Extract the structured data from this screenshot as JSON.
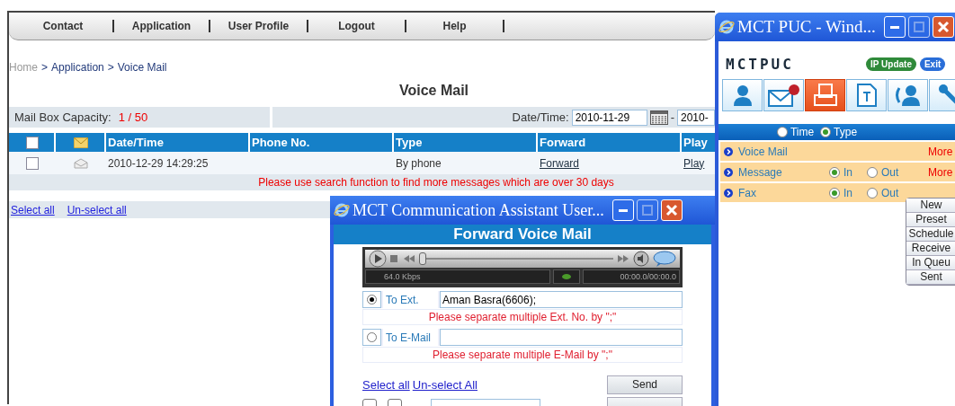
{
  "main": {
    "nav": [
      "Contact",
      "Application",
      "User Profile",
      "Logout",
      "Help"
    ],
    "breadcrumb": [
      {
        "label": "Home",
        "kind": "muted"
      },
      {
        "label": ">",
        "kind": "separator"
      },
      {
        "label": "Application",
        "kind": "link"
      },
      {
        "label": ">",
        "kind": "separator"
      },
      {
        "label": "Voice Mail",
        "kind": "link"
      }
    ],
    "title": "Voice Mail",
    "capacity": {
      "label": "Mail Box Capacity:",
      "value": "1 / 50"
    },
    "date_filter": {
      "label": "Date/Time:",
      "from": "2010-11-29",
      "separator": "-",
      "to": "2010-"
    },
    "table": {
      "header_checked": false,
      "columns": [
        "Date/Time",
        "Phone No.",
        "Type",
        "Forward",
        "Play"
      ],
      "rows": [
        {
          "checked": false,
          "date": "2010-12-29 14:29:25",
          "type": "By phone",
          "forward": "Forward",
          "play": "Play"
        }
      ]
    },
    "notice": "Please use search function to find more messages which are over 30 days",
    "select_all": "Select all",
    "unselect_all": "Un-select all"
  },
  "puc": {
    "title": "MCT PUC - Wind...",
    "logo": "MCTPUC",
    "buttons": [
      {
        "label": "IP Update",
        "kind": "green"
      },
      {
        "label": "Exit",
        "kind": "blue"
      }
    ],
    "tabs": [
      {
        "kind": "person",
        "selected": false
      },
      {
        "kind": "mail",
        "selected": false
      },
      {
        "kind": "fax",
        "selected": true
      },
      {
        "kind": "text",
        "selected": false
      },
      {
        "kind": "call",
        "selected": false
      },
      {
        "kind": "tool",
        "selected": false
      }
    ],
    "sort": [
      {
        "label": "Time",
        "selected": false
      },
      {
        "label": "Type",
        "selected": true
      }
    ],
    "categories": [
      {
        "label": "Voice Mail",
        "more": "More"
      },
      {
        "label": "Message",
        "directions": [
          {
            "label": "In",
            "selected": true
          },
          {
            "label": "Out",
            "selected": false
          }
        ],
        "more": "More"
      },
      {
        "label": "Fax",
        "directions": [
          {
            "label": "In",
            "selected": true
          },
          {
            "label": "Out",
            "selected": false
          }
        ]
      }
    ],
    "menu": [
      "New",
      "Preset",
      "Schedule",
      "Receive",
      "In Queu",
      "Sent"
    ]
  },
  "dialog": {
    "title": "MCT Communication Assistant User...",
    "heading": "Forward Voice Mail",
    "player": {
      "bitrate": "64.0 Kbps",
      "time": "00:00.0/00:00.0",
      "level": 0
    },
    "recipients": [
      {
        "label": "To Ext.",
        "selected": true,
        "value": "Aman Basra(6606);",
        "note": "Please separate multiple Ext. No. by \";\""
      },
      {
        "label": "To E-Mail",
        "selected": false,
        "note": "Please separate multiple E-Mail by \";\""
      }
    ],
    "select_all": "Select all",
    "unselect_all": "Un-select All",
    "send": "Send",
    "partial_row": [
      {
        "selected": false
      },
      {
        "selected": false
      }
    ]
  }
}
